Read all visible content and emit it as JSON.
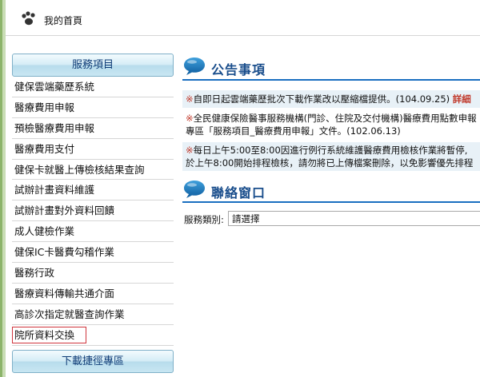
{
  "header": {
    "title": "我的首頁",
    "icon": "paw-icon"
  },
  "menu": {
    "heading": "服務項目",
    "items": [
      "健保雲端藥歷系統",
      "醫療費用申報",
      "預檢醫療費用申報",
      "醫療費用支付",
      "健保卡就醫上傳檢核結果查詢",
      "試辦計畫資料維護",
      "試辦計畫對外資料回饋",
      "成人健檢作業",
      "健保IC卡醫費勾稽作業",
      "醫務行政",
      "醫療資料傳輸共通介面",
      "高診次指定就醫查詢作業",
      "院所資料交換"
    ],
    "selected_index": 12,
    "footer": "下載捷徑專區"
  },
  "announcements": {
    "title": "公告事項",
    "notices": [
      {
        "mark": "※",
        "text": "自即日起雲端藥歷批次下載作業改以壓縮檔提供。(104.09.25)",
        "more": "詳細"
      },
      {
        "mark": "※",
        "line1": "全民健康保險醫事服務機構(門診、住院及交付機構)醫療費用點數申報",
        "line2": "專區「服務項目_醫療費用申報」文件。(102.06.13)"
      },
      {
        "mark": "※",
        "line1": "每日上午5:00至8:00因進行例行系統維護醫療費用檢核作業將暫停,",
        "line2": "於上午8:00開始排程檢核，請勿將已上傳檔案刪除，以免影響優先排程"
      }
    ]
  },
  "contact": {
    "title": "聯絡窗口",
    "label": "服務類別:",
    "select_value": "請選擇"
  },
  "colors": {
    "accent": "#1a4e8c",
    "highlight": "#c0392b",
    "notice_bg": "#e8f1f7",
    "rule": "#1a6fc0"
  }
}
